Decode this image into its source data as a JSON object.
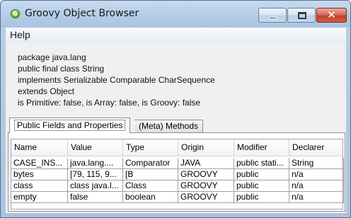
{
  "window": {
    "title": "Groovy Object Browser",
    "icon_letter": "G",
    "controls": {
      "close_glyph": "✕"
    }
  },
  "menu": {
    "items": [
      "Help"
    ]
  },
  "class_info": {
    "lines": [
      "package java.lang",
      "public final class String",
      "implements Serializable Comparable CharSequence",
      "extends Object",
      "is Primitive: false, is Array: false, is Groovy: false"
    ]
  },
  "tabs": [
    {
      "label": "Public Fields and Properties",
      "active": true
    },
    {
      "label": "(Meta) Methods",
      "active": false
    }
  ],
  "table": {
    "columns": [
      "Name",
      "Value",
      "Type",
      "Origin",
      "Modifier",
      "Declarer"
    ],
    "rows": [
      [
        "CASE_INS...",
        "java.lang....",
        "Comparator",
        "JAVA",
        "public stati...",
        "String"
      ],
      [
        "bytes",
        "[79, 115, 9...",
        "[B",
        "GROOVY",
        "public",
        "n/a"
      ],
      [
        "class",
        "class java.l...",
        "Class",
        "GROOVY",
        "public",
        "n/a"
      ],
      [
        "empty",
        "false",
        "boolean",
        "GROOVY",
        "public",
        "n/a"
      ]
    ]
  }
}
